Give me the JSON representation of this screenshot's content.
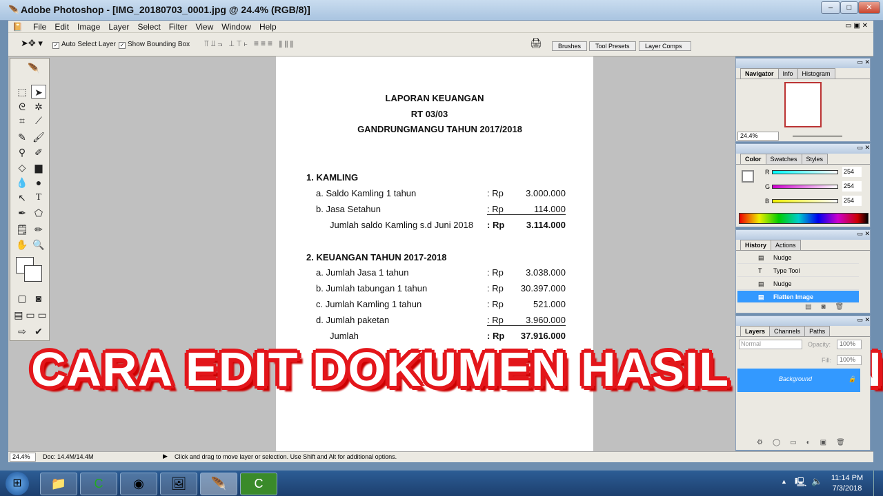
{
  "window": {
    "title": "Adobe Photoshop - [IMG_20180703_0001.jpg @ 24.4% (RGB/8)]"
  },
  "menu": [
    "File",
    "Edit",
    "Image",
    "Layer",
    "Select",
    "Filter",
    "View",
    "Window",
    "Help"
  ],
  "options": {
    "auto_select": "Auto Select Layer",
    "bounding_box": "Show Bounding Box",
    "wells": [
      "Brushes",
      "Tool Presets",
      "Layer Comps"
    ]
  },
  "document": {
    "title": [
      "LAPORAN KEUANGAN",
      "RT 03/03",
      "GANDRUNGMANGU TAHUN 2017/2018"
    ],
    "section1": {
      "heading": "1. KAMLING",
      "rows": [
        {
          "label": "a.  Saldo Kamling 1 tahun",
          "cur": ": Rp",
          "value": "3.000.000"
        },
        {
          "label": "b.  Jasa Setahun",
          "cur": ": Rp",
          "value": "114.000"
        },
        {
          "label": "Jumlah saldo Kamling s.d Juni 2018",
          "cur": ": Rp",
          "value": "3.114.000"
        }
      ]
    },
    "section2": {
      "heading": "2. KEUANGAN TAHUN 2017-2018",
      "rows": [
        {
          "label": "a.  Jumlah Jasa 1 tahun",
          "cur": ": Rp",
          "value": "3.038.000"
        },
        {
          "label": "b.  Jumlah tabungan 1 tahun",
          "cur": ": Rp",
          "value": "30.397.000"
        },
        {
          "label": "c.  Jumlah Kamling 1 tahun",
          "cur": ": Rp",
          "value": "521.000"
        },
        {
          "label": "d.  Jumlah paketan",
          "cur": ": Rp",
          "value": "3.960.000"
        },
        {
          "label": "Jumlah",
          "cur": ": Rp",
          "value": "37.916.000"
        }
      ]
    }
  },
  "overlay": "CARA EDIT DOKUMEN HASIL SCAN",
  "navigator": {
    "tabs": [
      "Navigator",
      "Info",
      "Histogram"
    ],
    "zoom": "24.4%"
  },
  "color": {
    "tabs": [
      "Color",
      "Swatches",
      "Styles"
    ],
    "r_label": "R",
    "g_label": "G",
    "b_label": "B",
    "r": "254",
    "g": "254",
    "b": "254"
  },
  "history": {
    "tabs": [
      "History",
      "Actions"
    ],
    "items": [
      "Nudge",
      "Type Tool",
      "Nudge",
      "Flatten Image"
    ]
  },
  "layers": {
    "tabs": [
      "Layers",
      "Channels",
      "Paths"
    ],
    "mode": "Normal",
    "opacity_label": "Opacity:",
    "opacity": "100%",
    "fill_label": "Fill:",
    "fill": "100%",
    "layer": "Background"
  },
  "status": {
    "zoom": "24.4%",
    "doc": "Doc: 14.4M/14.4M",
    "hint": "Click and drag to move layer or selection.  Use Shift and Alt for additional options."
  },
  "taskbar": {
    "time": "11:14 PM",
    "date": "7/3/2018"
  },
  "colors": {
    "accent": "#3399ff",
    "overlay_stroke": "#e3161b"
  }
}
